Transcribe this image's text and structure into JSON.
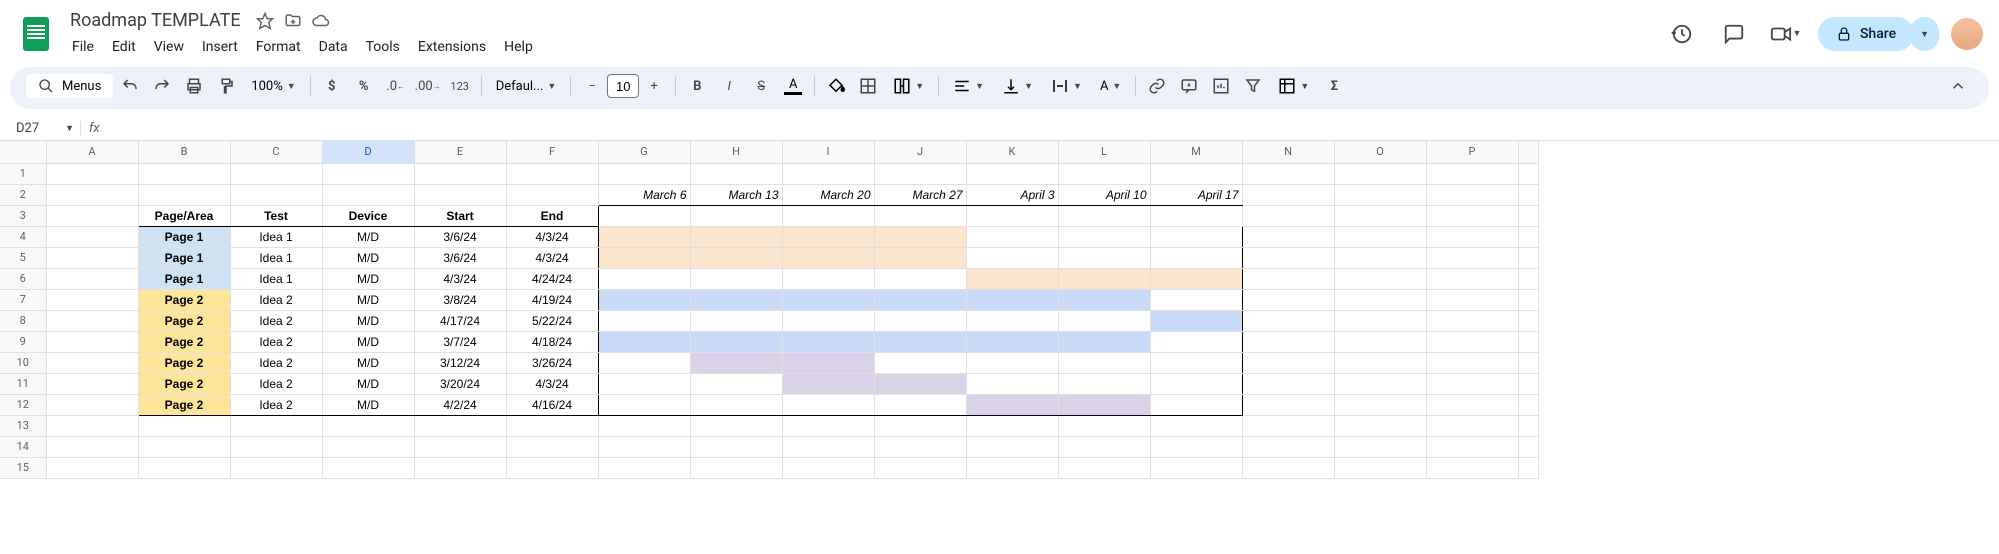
{
  "doc": {
    "title": "Roadmap TEMPLATE"
  },
  "menus": [
    "File",
    "Edit",
    "View",
    "Insert",
    "Format",
    "Data",
    "Tools",
    "Extensions",
    "Help"
  ],
  "toolbar": {
    "search_label": "Menus",
    "zoom": "100%",
    "font": "Defaul...",
    "font_size": "10"
  },
  "share": {
    "label": "Share"
  },
  "name_box": "D27",
  "columns": [
    "A",
    "B",
    "C",
    "D",
    "E",
    "F",
    "G",
    "H",
    "I",
    "J",
    "K",
    "L",
    "M",
    "N",
    "O",
    "P"
  ],
  "selected_col": "D",
  "row_count": 15,
  "dates": [
    "March 6",
    "March 13",
    "March 20",
    "March 27",
    "April 3",
    "April 10",
    "April 17"
  ],
  "table": {
    "headers": [
      "Page/Area",
      "Test",
      "Device",
      "Start",
      "End"
    ],
    "rows": [
      {
        "page": "Page 1",
        "test": "Idea 1",
        "device": "M/D",
        "start": "3/6/24",
        "end": "4/3/24",
        "pageBg": "bg-blue",
        "ganttBg": "bg-orange",
        "gantt": [
          0,
          1,
          2,
          3
        ]
      },
      {
        "page": "Page 1",
        "test": "Idea 1",
        "device": "M/D",
        "start": "3/6/24",
        "end": "4/3/24",
        "pageBg": "bg-blue",
        "ganttBg": "bg-orange",
        "gantt": [
          0,
          1,
          2,
          3
        ]
      },
      {
        "page": "Page 1",
        "test": "Idea 1",
        "device": "M/D",
        "start": "4/3/24",
        "end": "4/24/24",
        "pageBg": "bg-blue",
        "ganttBg": "bg-orange",
        "gantt": [
          4,
          5,
          6
        ]
      },
      {
        "page": "Page 2",
        "test": "Idea 2",
        "device": "M/D",
        "start": "3/8/24",
        "end": "4/19/24",
        "pageBg": "bg-yellow",
        "ganttBg": "bg-lblue",
        "gantt": [
          0,
          1,
          2,
          3,
          4,
          5
        ]
      },
      {
        "page": "Page 2",
        "test": "Idea 2",
        "device": "M/D",
        "start": "4/17/24",
        "end": "5/22/24",
        "pageBg": "bg-yellow",
        "ganttBg": "bg-lblue",
        "gantt": [
          6
        ]
      },
      {
        "page": "Page 2",
        "test": "Idea 2",
        "device": "M/D",
        "start": "3/7/24",
        "end": "4/18/24",
        "pageBg": "bg-yellow",
        "ganttBg": "bg-lblue",
        "gantt": [
          0,
          1,
          2,
          3,
          4,
          5
        ]
      },
      {
        "page": "Page 2",
        "test": "Idea 2",
        "device": "M/D",
        "start": "3/12/24",
        "end": "3/26/24",
        "pageBg": "bg-yellow",
        "ganttBg": "bg-purple",
        "gantt": [
          1,
          2
        ]
      },
      {
        "page": "Page 2",
        "test": "Idea 2",
        "device": "M/D",
        "start": "3/20/24",
        "end": "4/3/24",
        "pageBg": "bg-yellow",
        "ganttBg": "bg-purple",
        "gantt": [
          2,
          3
        ]
      },
      {
        "page": "Page 2",
        "test": "Idea 2",
        "device": "M/D",
        "start": "4/2/24",
        "end": "4/16/24",
        "pageBg": "bg-yellow",
        "ganttBg": "bg-purple",
        "gantt": [
          4,
          5
        ]
      }
    ]
  }
}
